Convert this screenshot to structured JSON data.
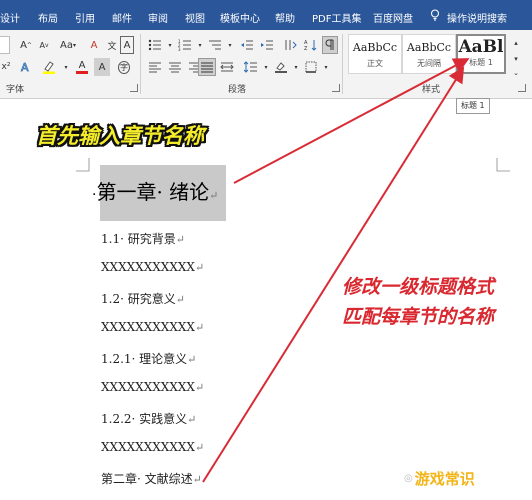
{
  "menu": [
    "设计",
    "布局",
    "引用",
    "邮件",
    "审阅",
    "视图",
    "模板中心",
    "帮助",
    "PDF工具集",
    "百度网盘",
    "操作说明搜索"
  ],
  "ribbon": {
    "font_group": {
      "label": "字体",
      "grow_font": "A",
      "shrink_font": "A",
      "change_case": "Aa",
      "clear_format": "A",
      "char_border": "A",
      "superscript": "x²",
      "font_color": "A",
      "char_shading": "A",
      "enclose_char": "字"
    },
    "paragraph_group": {
      "label": "段落"
    },
    "styles_group": {
      "label": "样式",
      "tiles": [
        {
          "sample": "AaBbCc",
          "name": "正文"
        },
        {
          "sample": "AaBbCc",
          "name": "无间隔"
        },
        {
          "sample": "AaBl",
          "name": "标题 1"
        }
      ]
    },
    "tooltip": "标题 1"
  },
  "document": {
    "lines": [
      {
        "text": "第一章· 绪论",
        "mark": "↵"
      },
      {
        "text": "1.1· 研究背景",
        "mark": "↵"
      },
      {
        "text": "XXXXXXXXXXX",
        "mark": "↵"
      },
      {
        "text": "1.2· 研究意义",
        "mark": "↵"
      },
      {
        "text": "XXXXXXXXXXX",
        "mark": "↵"
      },
      {
        "text": "1.2.1· 理论意义",
        "mark": "↵"
      },
      {
        "text": "XXXXXXXXXXX",
        "mark": "↵"
      },
      {
        "text": "1.2.2· 实践意义",
        "mark": "↵"
      },
      {
        "text": "XXXXXXXXXXX",
        "mark": "↵"
      },
      {
        "text": "第二章· 文献综述",
        "mark": "↵"
      }
    ]
  },
  "annotations": {
    "callout_1": "首先输入章节名称",
    "callout_2_line1": "修改一级标题格式",
    "callout_2_line2": "匹配每章节的名称",
    "watermark": "游戏常识"
  },
  "colors": {
    "menubar": "#2b579a",
    "callout_red": "#d9282f",
    "callout_yellow": "#f5ec2a",
    "arrow": "#d92b35",
    "heading_highlight": "#c9c9c9"
  }
}
